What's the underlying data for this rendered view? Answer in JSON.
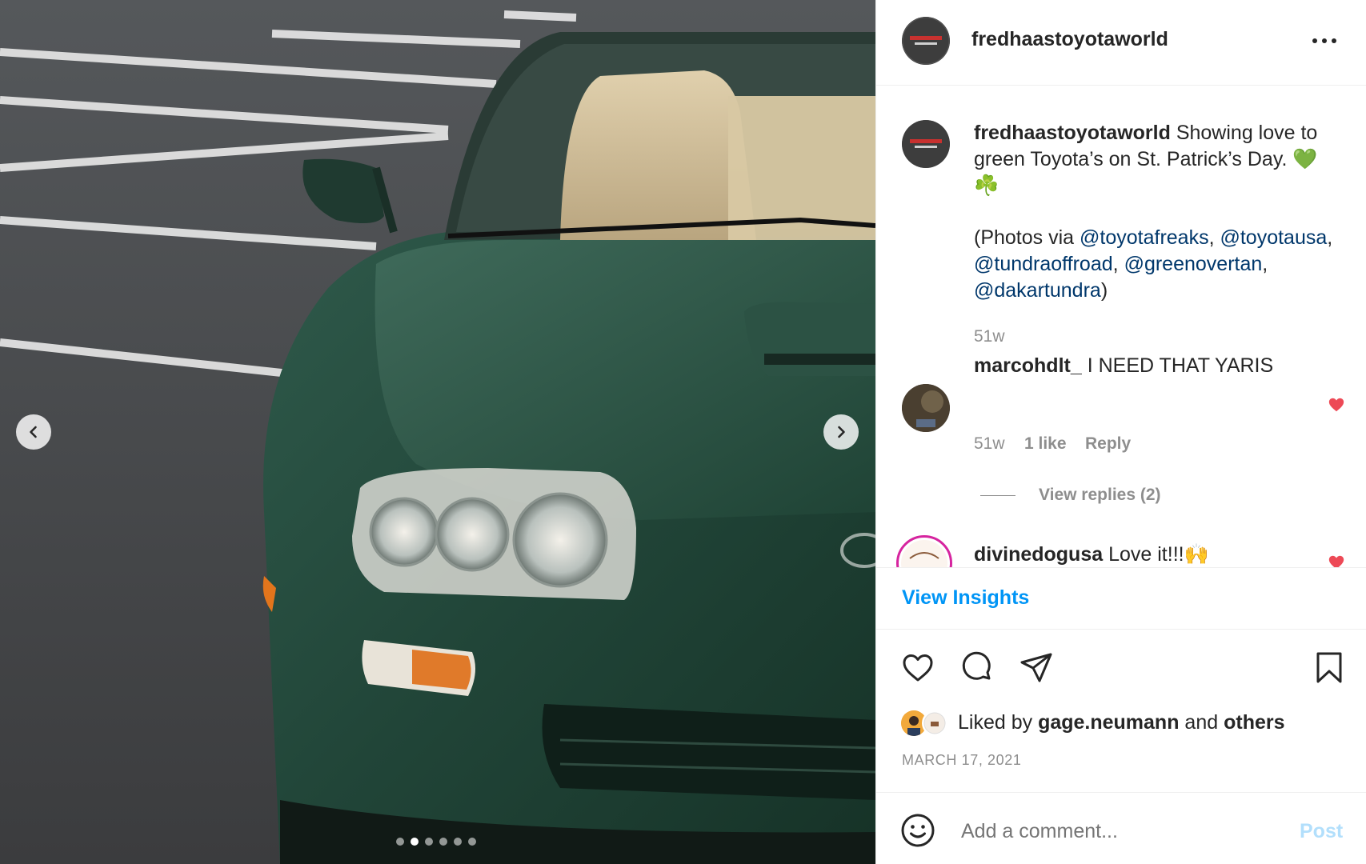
{
  "post": {
    "username": "fredhaastoyotaworld",
    "more_label": "More options",
    "carousel": {
      "total": 6,
      "active_index": 1
    }
  },
  "caption": {
    "username": "fredhaastoyotaworld",
    "text": " Showing love to green Toyota’s on St. Patrick’s Day. 💚 ☘️",
    "photos_prefix": "(Photos via ",
    "mentions": [
      "@toyotafreaks",
      "@toyotausa",
      "@tundraoffroad",
      "@greenovertan",
      "@dakartundra"
    ],
    "sep": ", ",
    "photos_suffix": ")",
    "time": "51w"
  },
  "comments": [
    {
      "username": "marcohdlt_",
      "text": " I NEED THAT YARIS",
      "time": "51w",
      "likes": "1 like",
      "reply": "Reply",
      "view_replies": "View replies (2)"
    },
    {
      "username": "divinedogusa",
      "text": " Love it!!!🙌"
    }
  ],
  "insights_label": "View Insights",
  "actions": [
    "like",
    "comment",
    "share",
    "save"
  ],
  "liked_by": {
    "prefix": "Liked by ",
    "user": "gage.neumann",
    "middle": " and ",
    "others": "others"
  },
  "date": "MARCH 17, 2021",
  "comment_box": {
    "placeholder": "Add a comment...",
    "post_label": "Post"
  },
  "colors": {
    "link": "#00376b",
    "accent": "#0095f6",
    "heart": "#ed4956",
    "muted": "#8e8e8e"
  }
}
